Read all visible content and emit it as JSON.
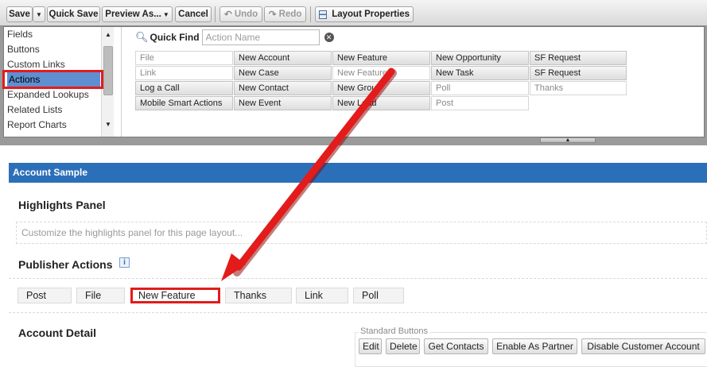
{
  "toolbar": {
    "save": "Save",
    "save_menu": "▼",
    "quick_save": "Quick Save",
    "preview_as": "Preview As...",
    "preview_menu": "▼",
    "cancel": "Cancel",
    "undo": "Undo",
    "redo": "Redo",
    "layout_properties": "Layout Properties"
  },
  "palette": {
    "categories": [
      "Fields",
      "Buttons",
      "Custom Links",
      "Actions",
      "Expanded Lookups",
      "Related Lists",
      "Report Charts"
    ],
    "selected_category": "Actions",
    "quick_find": {
      "label": "Quick Find",
      "placeholder": "Action Name"
    },
    "tiles": [
      [
        "File",
        "New Account",
        "New Feature",
        "New Opportunity",
        "SF Request"
      ],
      [
        "Link",
        "New Case",
        "New Feature",
        "New Task",
        "SF Request"
      ],
      [
        "Log a Call",
        "New Contact",
        "New Group",
        "Poll",
        "Thanks"
      ],
      [
        "Mobile Smart Actions",
        "New Event",
        "New Lead",
        "Post",
        ""
      ]
    ],
    "used_tiles": [
      "File",
      "Link",
      "New Feature",
      "Poll",
      "Thanks",
      "Post"
    ]
  },
  "layout": {
    "header": "Account Sample",
    "highlights_title": "Highlights Panel",
    "highlights_placeholder": "Customize the highlights panel for this page layout...",
    "publisher_title": "Publisher Actions",
    "publisher_info": "i",
    "publisher_actions": [
      "Post",
      "File",
      "New Feature",
      "Thanks",
      "Link",
      "Poll"
    ],
    "detail_title": "Account Detail",
    "standard_buttons_label": "Standard Buttons",
    "standard_buttons": [
      "Edit",
      "Delete",
      "Get Contacts",
      "Enable As Partner",
      "Disable Customer Account"
    ]
  },
  "colors": {
    "annotation_red": "#e31b1b",
    "header_blue": "#2c6fb9",
    "selected_blue": "#5f8fd0"
  },
  "icons": {
    "undo": "undo-icon",
    "redo": "redo-icon",
    "layout_properties": "layout-properties-icon",
    "quick_find": "magnifier-icon",
    "clear": "clear-icon"
  }
}
